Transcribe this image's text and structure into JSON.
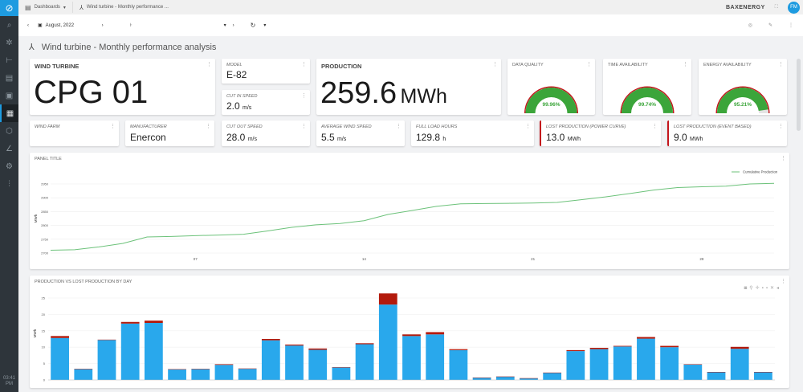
{
  "sidebar": {
    "time": "03:41",
    "ampm": "PM",
    "items": [
      "logo",
      "search-icon",
      "bug-icon",
      "tree-icon",
      "calendar-icon",
      "monitor-icon",
      "dashboard-icon",
      "plugin-icon",
      "chart-icon",
      "cogs-icon",
      "sliders-icon"
    ]
  },
  "topbar": {
    "dashboards": "Dashboards",
    "breadcrumb": "Wind turbine - Monthly performance ...",
    "brand": "BAXENERGY",
    "avatar": "FM"
  },
  "toolbar": {
    "date": "August, 2022"
  },
  "page": {
    "title": "Wind turbine - Monthly performance analysis"
  },
  "cards": {
    "wind_turbine": {
      "label": "WIND TURBINE",
      "value": "CPG 01"
    },
    "model": {
      "label": "MODEL",
      "value": "E-82"
    },
    "cut_in": {
      "label": "CUT IN SPEED",
      "value": "2.0",
      "unit": "m/s"
    },
    "production": {
      "label": "PRODUCTION",
      "value": "259.6",
      "unit": "MWh"
    },
    "data_quality": {
      "label": "DATA QUALITY",
      "value": "99.96%",
      "pct": 99.96
    },
    "time_availability": {
      "label": "TIME AVAILABILITY",
      "value": "99.74%",
      "pct": 99.74
    },
    "energy_availability": {
      "label": "ENERGY AVAILABILITY",
      "value": "95.21%",
      "pct": 95.21
    },
    "wind_farm": {
      "label": "WIND FARM",
      "value": ""
    },
    "manufacturer": {
      "label": "MANUFACTURER",
      "value": "Enercon"
    },
    "cut_out": {
      "label": "CUT OUT SPEED",
      "value": "28.0",
      "unit": "m/s"
    },
    "avg_wind": {
      "label": "AVERAGE WIND SPEED",
      "value": "5.5",
      "unit": "m/s"
    },
    "full_load": {
      "label": "FULL LOAD HOURS",
      "value": "129.8",
      "unit": "h"
    },
    "lost_power": {
      "label": "LOST PRODUCTION (POWER CURVE)",
      "value": "13.0",
      "unit": "MWh"
    },
    "lost_event": {
      "label": "LOST PRODUCTION (EVENT BASED)",
      "value": "9.0",
      "unit": "MWh"
    }
  },
  "colors": {
    "accent": "#1e9be0",
    "green": "#3ba53a",
    "red": "#c4161c",
    "bar_blue": "#29a8ec",
    "bar_red": "#b31a0c",
    "line": "#6cc27a"
  },
  "chart_data": [
    {
      "type": "line",
      "title": "PANEL TITLE",
      "ylabel": "MWh",
      "ylim": [
        2700,
        2950
      ],
      "yticks": [
        "2700",
        "2750",
        "2800",
        "2850",
        "2900",
        "2950"
      ],
      "xticks": [
        "07",
        "14",
        "21",
        "28"
      ],
      "legend": "top-right",
      "series": [
        {
          "name": "Cumulative Production",
          "x": [
            1,
            2,
            3,
            4,
            5,
            6,
            7,
            8,
            9,
            10,
            11,
            12,
            13,
            14,
            15,
            16,
            17,
            18,
            19,
            20,
            21,
            22,
            23,
            24,
            25,
            26,
            27,
            28,
            29,
            30,
            31
          ],
          "values": [
            2710,
            2712,
            2722,
            2735,
            2758,
            2760,
            2763,
            2765,
            2768,
            2780,
            2793,
            2802,
            2807,
            2817,
            2840,
            2854,
            2869,
            2878,
            2879,
            2880,
            2881,
            2883,
            2893,
            2903,
            2915,
            2928,
            2937,
            2940,
            2942,
            2950,
            2952
          ]
        }
      ]
    },
    {
      "type": "bar",
      "title": "PRODUCTION VS LOST PRODUCTION BY DAY",
      "ylabel": "MWh",
      "ylim": [
        0,
        27
      ],
      "yticks": [
        "0",
        "5",
        "10",
        "15",
        "20",
        "25"
      ],
      "stacked": true,
      "categories": [
        1,
        2,
        3,
        4,
        5,
        6,
        7,
        8,
        9,
        10,
        11,
        12,
        13,
        14,
        15,
        16,
        17,
        18,
        19,
        20,
        21,
        22,
        23,
        24,
        25,
        26,
        27,
        28,
        29,
        30,
        31
      ],
      "series": [
        {
          "values": [
            12.8,
            3.3,
            12.2,
            17.2,
            17.4,
            3.2,
            3.3,
            4.6,
            3.4,
            12.1,
            10.5,
            9.2,
            3.8,
            10.9,
            23.0,
            13.4,
            13.9,
            9.1,
            0.7,
            1.0,
            0.5,
            2.2,
            8.8,
            9.4,
            10.2,
            12.6,
            10.0,
            4.7,
            2.4,
            9.5,
            2.4
          ]
        },
        {
          "values": [
            0.6,
            0.1,
            0.1,
            0.5,
            0.7,
            0.1,
            0.1,
            0.2,
            0.1,
            0.4,
            0.3,
            0.4,
            0.1,
            0.3,
            3.4,
            0.5,
            0.7,
            0.3,
            0.05,
            0.05,
            0.05,
            0.05,
            0.3,
            0.4,
            0.2,
            0.5,
            0.4,
            0.1,
            0.05,
            0.6,
            0.05
          ]
        }
      ]
    }
  ]
}
